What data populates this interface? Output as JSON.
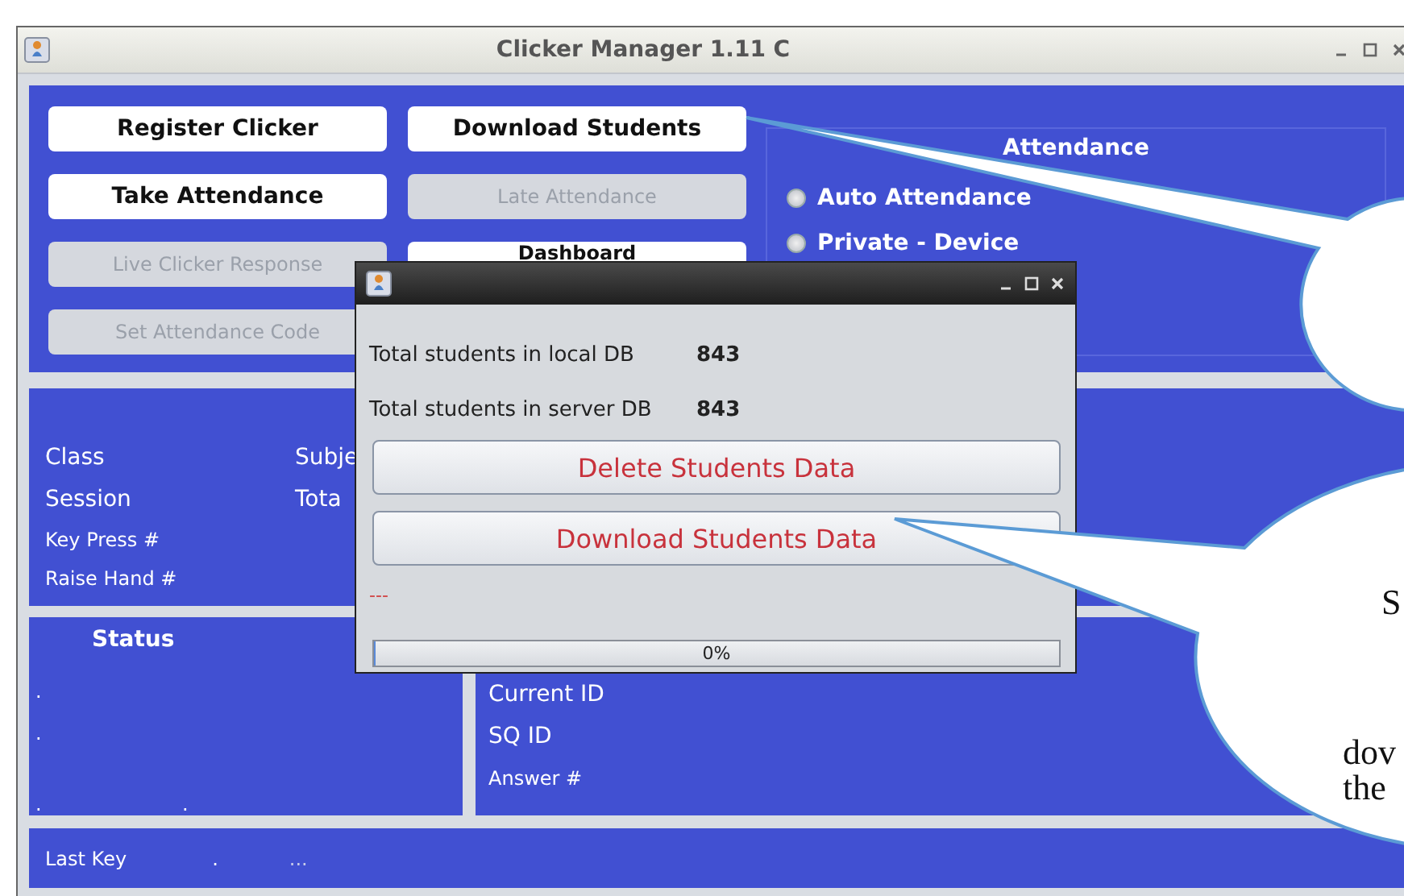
{
  "window": {
    "title": "Clicker Manager 1.11 C"
  },
  "buttons": [
    {
      "label": "Register Clicker",
      "disabled": false
    },
    {
      "label": "Download Students",
      "disabled": false
    },
    {
      "label": "Take Attendance",
      "disabled": false
    },
    {
      "label": "Late Attendance",
      "disabled": true
    },
    {
      "label": "Live Clicker Response",
      "disabled": true
    },
    {
      "label": "Dashboard",
      "disabled": false
    },
    {
      "label": "Set Attendance Code",
      "disabled": true
    }
  ],
  "attendance": {
    "title": "Attendance",
    "options": [
      {
        "label": "Auto Attendance",
        "selected": false
      },
      {
        "label": "Private - Device",
        "selected": false
      }
    ]
  },
  "session_info": {
    "left": [
      "Class",
      "Session",
      "Key Press #",
      "Raise Hand #"
    ],
    "right": [
      "Subje",
      "Tota"
    ]
  },
  "status": {
    "title": "Status",
    "marks": [
      ".",
      ".",
      ".",
      "."
    ]
  },
  "question_info": [
    "Current ID",
    "SQ ID",
    "Answer #"
  ],
  "last_key": {
    "label": "Last Key",
    "value": ".",
    "detail": "..."
  },
  "dialog": {
    "rows": [
      {
        "label": "Total students in local DB",
        "value": "843"
      },
      {
        "label": "Total students in server DB",
        "value": "843"
      }
    ],
    "buttons": [
      "Delete Students Data",
      "Download Students Data"
    ],
    "message": "---",
    "progress": {
      "level": 0,
      "text": "0%"
    }
  },
  "callout": {
    "lines": [
      "S",
      "dov",
      "the"
    ]
  }
}
